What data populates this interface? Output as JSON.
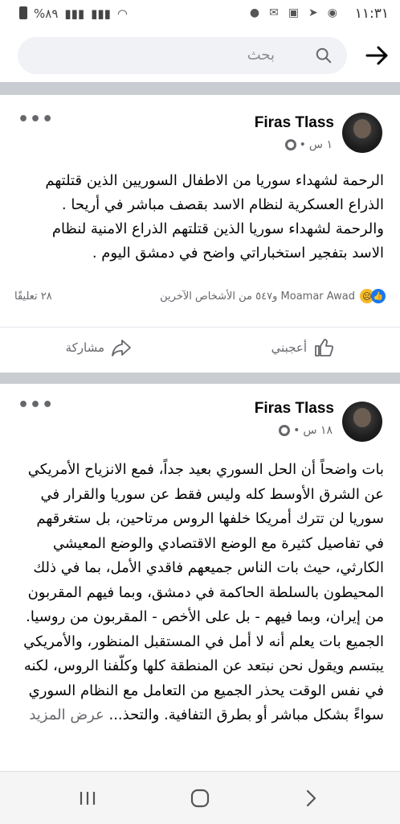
{
  "status_bar": {
    "time": "١١:٣١",
    "battery": "%٨٩"
  },
  "search": {
    "placeholder": "بحث"
  },
  "posts": [
    {
      "author": "Firas Tlass",
      "time": "١ س",
      "separator": "•",
      "paragraphs": [
        "الرحمة لشهداء سوريا من الاطفال السوريين الذين قتلتهم الذراع العسكرية لنظام الاسد  بقصف مباشر في أريحا .",
        "والرحمة لشهداء سوريا الذين  قتلتهم الذراع الامنية  لنظام الاسد بتفجير استخباراتي واضح في دمشق اليوم ."
      ],
      "reactions_text": "Moamar Awad و٥٤٧ من الأشخاص الآخرين",
      "comments_text": "٢٨ تعليقًا",
      "like_label": "أعجبني",
      "share_label": "مشاركة"
    },
    {
      "author": "Firas Tlass",
      "time": "١٨ س",
      "separator": "•",
      "paragraphs": [
        "بات واضحاً أن الحل السوري بعيد جداً، فمع الانزياح الأمريكي عن الشرق الأوسط كله وليس فقط عن سوريا والقرار في سوريا لن تترك أمريكا خلفها الروس مرتاحين، بل ستغرقهم في تفاصيل كثيرة مع الوضع الاقتصادي والوضع المعيشي الكارثي، حيث بات الناس جميعهم فاقدي الأمل، بما في ذلك المحيطون بالسلطة الحاكمة في دمشق، وبما فيهم المقربون من إيران، وبما فيهم - بل على الأخص - المقربون من روسيا.",
        "الجميع بات يعلم أنه لا أمل في المستقبل المنظور، والأمريكي يبتسم ويقول نحن نبتعد عن المنطقة كلها وكلّفنا الروس، لكنه في نفس الوقت يحذر الجميع من التعامل مع النظام السوري سواءً بشكل مباشر أو بطرق التفافية. والتحذ..."
      ],
      "see_more": "عرض المزيد"
    }
  ],
  "icons": {
    "back": "back-arrow-icon",
    "search": "search-icon",
    "more": "more-horizontal-icon",
    "globe": "globe-icon",
    "like": "thumbs-up-icon",
    "share": "share-icon",
    "recents": "recents-icon",
    "home": "home-icon",
    "nav_back": "nav-back-icon"
  },
  "colors": {
    "divider": "#c9ccd1",
    "like_blue": "#1877f2",
    "secondary_text": "#65676b"
  }
}
